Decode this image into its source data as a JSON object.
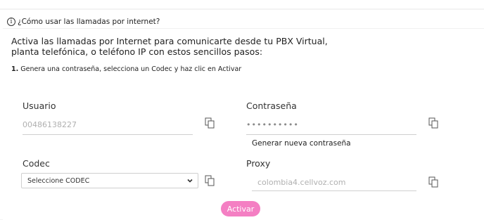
{
  "help": {
    "link_text": "¿Cómo usar las llamadas por internet?"
  },
  "intro": {
    "text": "Activa las llamadas por Internet para comunicarte desde tu PBX Virtual, planta telefónica, o teléfono IP con estos sencillos pasos:"
  },
  "step1": {
    "number": "1.",
    "text": " Genera una contraseña, selecciona un Codec y haz clic en Activar"
  },
  "usuario": {
    "label": "Usuario",
    "value": "00486138227"
  },
  "contrasena": {
    "label": "Contraseña",
    "value": "••••••••••",
    "generate_link": "Generar nueva contraseña"
  },
  "codec": {
    "label": "Codec",
    "selected": "Seleccione CODEC"
  },
  "proxy": {
    "label": "Proxy",
    "value": "colombia4.cellvoz.com"
  },
  "actions": {
    "activate_label": "Activar"
  },
  "colors": {
    "accent": "#f47fc3"
  },
  "icons": {
    "help": "info-icon",
    "copy": "copy-icon",
    "dropdown": "chevron-down-icon"
  }
}
